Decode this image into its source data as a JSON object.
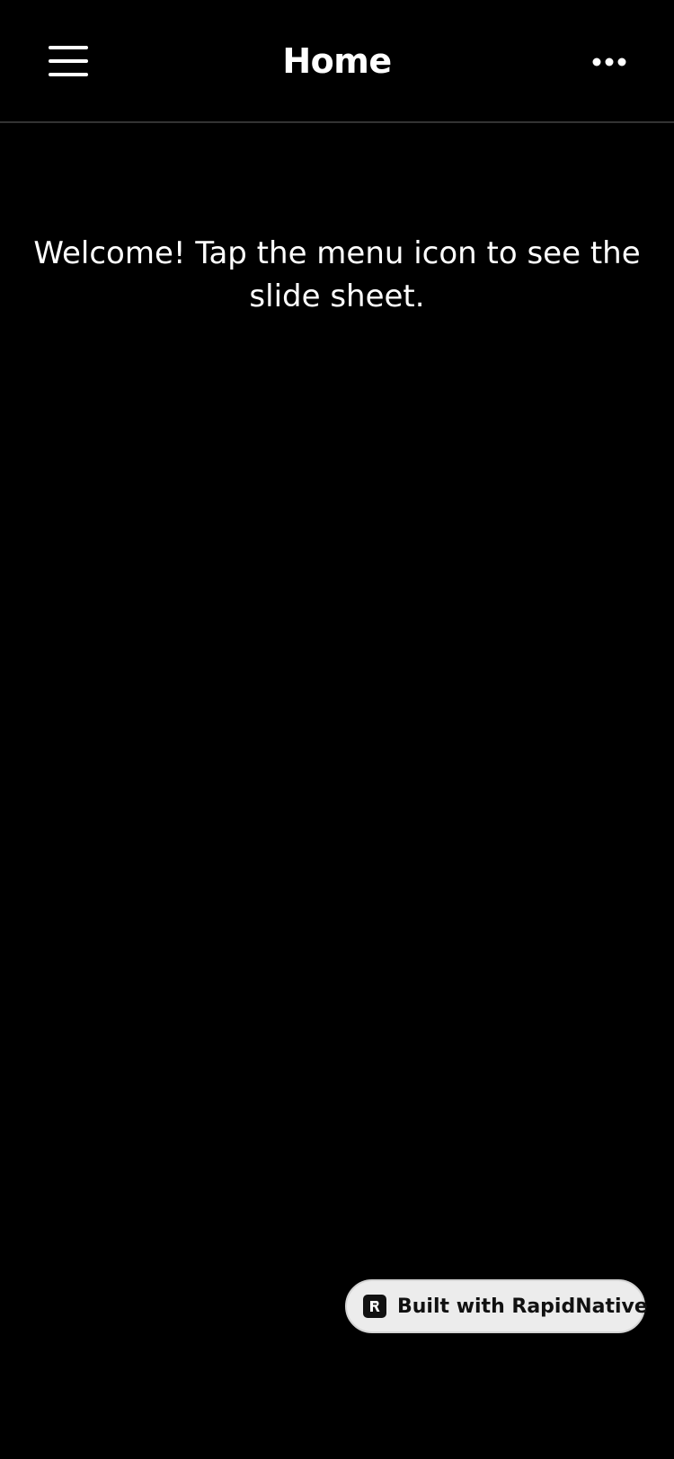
{
  "header": {
    "title": "Home",
    "menu_icon": "hamburger-menu-icon",
    "more_icon": "more-horizontal-icon"
  },
  "main": {
    "welcome_text": "Welcome! Tap the menu icon to see the slide sheet."
  },
  "badge": {
    "label": "Built with RapidNative",
    "logo_icon": "rapidnative-logo-icon"
  },
  "colors": {
    "background": "#000000",
    "text": "#ffffff",
    "divider": "#333333",
    "badge_background": "#ececec",
    "badge_text": "#111111"
  }
}
